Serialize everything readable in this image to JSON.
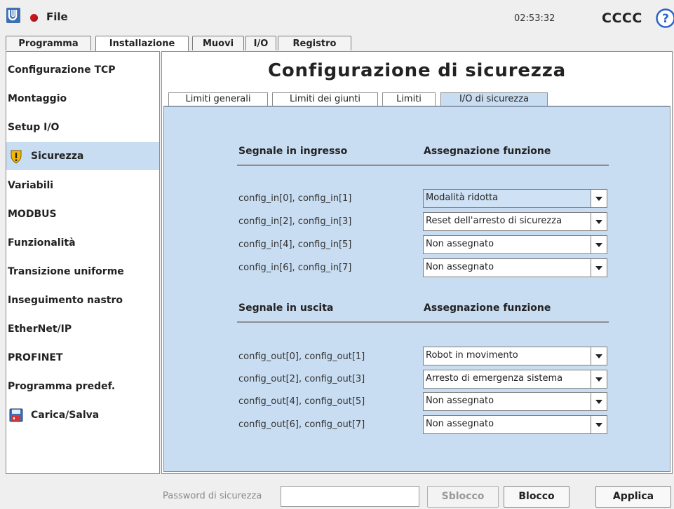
{
  "topbar": {
    "file_label": "File",
    "time": "02:53:32",
    "robot_name": "CCCC",
    "help_glyph": "?"
  },
  "main_tabs": [
    {
      "label": "Programma",
      "active": false
    },
    {
      "label": "Installazione",
      "active": true
    },
    {
      "label": "Muovi",
      "active": false
    },
    {
      "label": "I/O",
      "active": false
    },
    {
      "label": "Registro",
      "active": false
    }
  ],
  "sidebar": {
    "items": [
      {
        "label": "Configurazione TCP"
      },
      {
        "label": "Montaggio"
      },
      {
        "label": "Setup I/O"
      },
      {
        "label": "Sicurezza",
        "icon": "warning-icon",
        "active": true
      },
      {
        "label": "Variabili"
      },
      {
        "label": "MODBUS"
      },
      {
        "label": "Funzionalità"
      },
      {
        "label": "Transizione uniforme"
      },
      {
        "label": "Inseguimento nastro"
      },
      {
        "label": "EtherNet/IP"
      },
      {
        "label": "PROFINET"
      },
      {
        "label": "Programma predef."
      },
      {
        "label": "Carica/Salva",
        "icon": "floppy-disk-icon"
      }
    ]
  },
  "page": {
    "title": "Configurazione di sicurezza"
  },
  "sub_tabs": [
    {
      "label": "Limiti generali",
      "active": false
    },
    {
      "label": "Limiti dei giunti",
      "active": false
    },
    {
      "label": "Limiti",
      "active": false
    },
    {
      "label": "I/O di sicurezza",
      "active": true
    }
  ],
  "inputs": {
    "header_signal": "Segnale in ingresso",
    "header_function": "Assegnazione funzione",
    "rows": [
      {
        "signal": "config_in[0], config_in[1]",
        "function": "Modalità ridotta",
        "highlight": true
      },
      {
        "signal": "config_in[2], config_in[3]",
        "function": "Reset dell'arresto di sicurezza"
      },
      {
        "signal": "config_in[4], config_in[5]",
        "function": "Non assegnato"
      },
      {
        "signal": "config_in[6], config_in[7]",
        "function": "Non assegnato"
      }
    ]
  },
  "outputs": {
    "header_signal": "Segnale in uscita",
    "header_function": "Assegnazione funzione",
    "rows": [
      {
        "signal": "config_out[0], config_out[1]",
        "function": "Robot in movimento"
      },
      {
        "signal": "config_out[2], config_out[3]",
        "function": "Arresto di emergenza sistema"
      },
      {
        "signal": "config_out[4], config_out[5]",
        "function": "Non assegnato"
      },
      {
        "signal": "config_out[6], config_out[7]",
        "function": "Non assegnato"
      }
    ]
  },
  "bottombar": {
    "password_label": "Password di sicurezza",
    "password_value": "",
    "unlock_label": "Sblocco",
    "lock_label": "Blocco",
    "apply_label": "Applica"
  },
  "colors": {
    "accent": "#c9ddf2",
    "record": "#c8171b",
    "help": "#2b64c7"
  }
}
